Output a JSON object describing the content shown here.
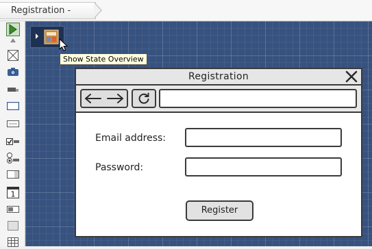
{
  "breadcrumb": {
    "label": "Registration - Initial"
  },
  "palette": {
    "items": [
      {
        "icon": "select-arrow-icon"
      },
      {
        "icon": "scroll-up-icon"
      },
      {
        "icon": "image-placeholder-icon"
      },
      {
        "icon": "camera-icon"
      },
      {
        "icon": "label-icon"
      },
      {
        "icon": "button-icon"
      },
      {
        "icon": "text-field-icon"
      },
      {
        "icon": "checkbox-icon"
      },
      {
        "icon": "radio-icon"
      },
      {
        "icon": "combo-box-icon"
      },
      {
        "icon": "calendar-icon"
      },
      {
        "icon": "toggle-icon"
      },
      {
        "icon": "panel-icon"
      },
      {
        "icon": "table-icon"
      }
    ],
    "calendar_day": "1"
  },
  "canvas": {
    "tooltip": "Show State Overview"
  },
  "wireframe": {
    "title": "Registration",
    "email_label": "Email address:",
    "email_value": "",
    "password_label": "Password:",
    "password_value": "",
    "url_value": "",
    "register_label": "Register"
  }
}
